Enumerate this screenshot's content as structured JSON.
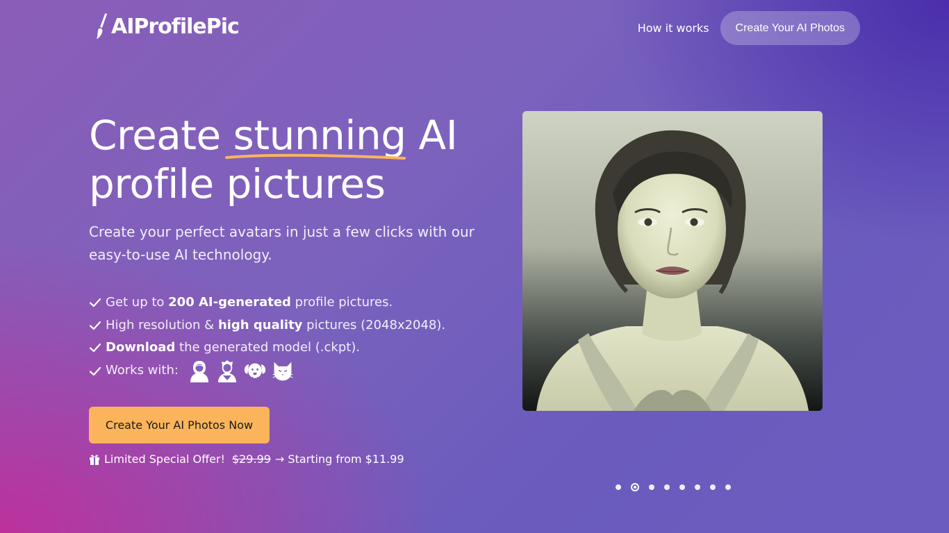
{
  "header": {
    "logo_text": "AIProfilePic",
    "nav_link": "How it works",
    "nav_cta": "Create Your AI Photos"
  },
  "hero": {
    "title_before": "Create ",
    "title_highlight": "stunning",
    "title_after": " AI",
    "title_line2": "profile pictures",
    "subtitle": "Create your perfect avatars in just a few clicks with our easy-to-use AI technology.",
    "features": [
      {
        "pre": "Get up to ",
        "bold": "200 AI-generated",
        "post": " profile pictures."
      },
      {
        "pre": "High resolution & ",
        "bold": "high quality",
        "post": " pictures (2048x2048)."
      },
      {
        "pre": "",
        "bold": "Download",
        "post": " the generated model (.ckpt)."
      },
      {
        "pre": "Works with:",
        "bold": "",
        "post": ""
      }
    ],
    "works_with_icons": [
      "woman-icon",
      "man-icon",
      "dog-icon",
      "cat-icon"
    ],
    "cta_label": "Create Your AI Photos Now",
    "offer_label": "Limited Special Offer!",
    "offer_old_price": "$29.99",
    "offer_new_price": "→ Starting from $11.99"
  },
  "carousel": {
    "slide_count": 8,
    "active_index": 1
  },
  "colors": {
    "accent": "#fbb45c",
    "underline": "#fbb45c"
  }
}
